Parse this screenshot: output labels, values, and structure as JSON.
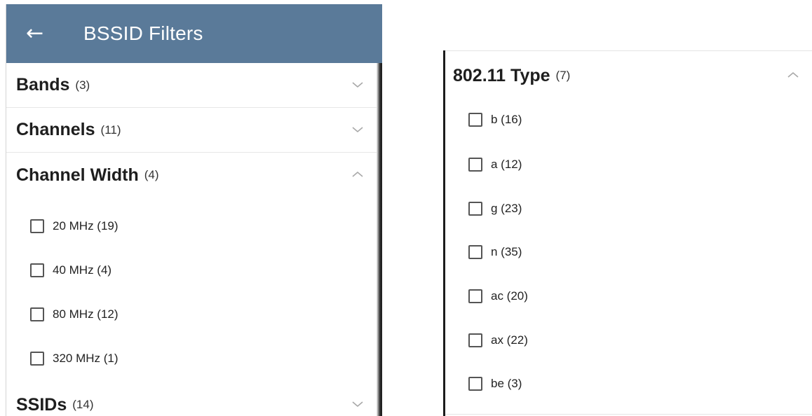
{
  "left_panel": {
    "header": {
      "back_icon": "arrow-left-icon",
      "title": "BSSID Filters",
      "color": "#5a7a99"
    },
    "sections": [
      {
        "title": "Bands",
        "count": "(3)",
        "expanded": false
      },
      {
        "title": "Channels",
        "count": "(11)",
        "expanded": false
      },
      {
        "title": "Channel Width",
        "count": "(4)",
        "expanded": true
      },
      {
        "title": "SSIDs",
        "count": "(14)",
        "expanded": false
      }
    ],
    "channel_width_options": [
      {
        "label": "20 MHz (19)",
        "checked": false
      },
      {
        "label": "40 MHz (4)",
        "checked": false
      },
      {
        "label": "80 MHz (12)",
        "checked": false
      },
      {
        "label": "320 MHz (1)",
        "checked": false
      }
    ]
  },
  "right_panel": {
    "section": {
      "title": "802.11 Type",
      "count": "(7)",
      "expanded": true
    },
    "options": [
      {
        "label": "b (16)",
        "checked": false
      },
      {
        "label": "a (12)",
        "checked": false
      },
      {
        "label": "g (23)",
        "checked": false
      },
      {
        "label": "n (35)",
        "checked": false
      },
      {
        "label": "ac (20)",
        "checked": false
      },
      {
        "label": "ax (22)",
        "checked": false
      },
      {
        "label": "be (3)",
        "checked": false
      }
    ]
  }
}
